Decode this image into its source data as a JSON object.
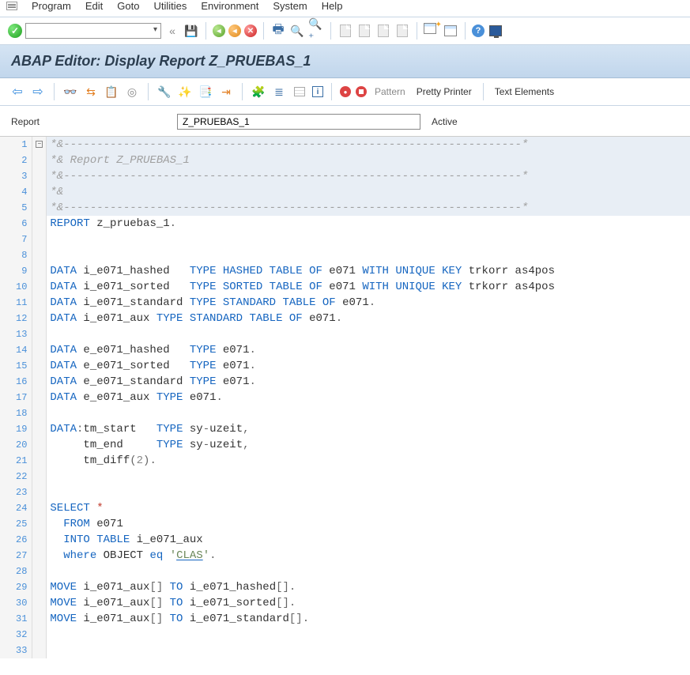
{
  "menubar": {
    "items": [
      "Program",
      "Edit",
      "Goto",
      "Utilities",
      "Environment",
      "System",
      "Help"
    ]
  },
  "title": "ABAP Editor: Display Report Z_PRUEBAS_1",
  "apptoolbar": {
    "pattern": "Pattern",
    "pretty": "Pretty Printer",
    "textelem": "Text Elements"
  },
  "report": {
    "label": "Report",
    "value": "Z_PRUEBAS_1",
    "status": "Active"
  },
  "code": {
    "lines": [
      {
        "n": 1,
        "hl": true,
        "html": "<span class='cmt'>*&---------------------------------------------------------------------*</span>"
      },
      {
        "n": 2,
        "hl": true,
        "html": "<span class='cmt'>*& Report Z_PRUEBAS_1</span>"
      },
      {
        "n": 3,
        "hl": true,
        "html": "<span class='cmt'>*&---------------------------------------------------------------------*</span>"
      },
      {
        "n": 4,
        "hl": true,
        "html": "<span class='cmt'>*&</span>"
      },
      {
        "n": 5,
        "hl": true,
        "html": "<span class='cmt'>*&---------------------------------------------------------------------*</span>"
      },
      {
        "n": 6,
        "hl": false,
        "html": "<span class='kw'>REPORT</span> <span class='id'>z_pruebas_1</span><span class='op'>.</span>"
      },
      {
        "n": 7,
        "hl": false,
        "html": ""
      },
      {
        "n": 8,
        "hl": false,
        "html": ""
      },
      {
        "n": 9,
        "hl": false,
        "html": "<span class='kw'>DATA</span> <span class='id'>i_e071_hashed</span>   <span class='kw'>TYPE HASHED TABLE OF</span> <span class='id'>e071</span> <span class='kw'>WITH UNIQUE KEY</span> <span class='id'>trkorr as4pos</span>"
      },
      {
        "n": 10,
        "hl": false,
        "html": "<span class='kw'>DATA</span> <span class='id'>i_e071_sorted</span>   <span class='kw'>TYPE SORTED TABLE OF</span> <span class='id'>e071</span> <span class='kw'>WITH UNIQUE KEY</span> <span class='id'>trkorr as4pos</span>"
      },
      {
        "n": 11,
        "hl": false,
        "html": "<span class='kw'>DATA</span> <span class='id'>i_e071_standard</span> <span class='kw'>TYPE STANDARD TABLE OF</span> <span class='id'>e071</span><span class='op'>.</span>"
      },
      {
        "n": 12,
        "hl": false,
        "html": "<span class='kw'>DATA</span> <span class='id'>i_e071_aux</span> <span class='kw'>TYPE STANDARD TABLE OF</span> <span class='id'>e071</span><span class='op'>.</span>"
      },
      {
        "n": 13,
        "hl": false,
        "html": ""
      },
      {
        "n": 14,
        "hl": false,
        "html": "<span class='kw'>DATA</span> <span class='id'>e_e071_hashed</span>   <span class='kw'>TYPE</span> <span class='id'>e071</span><span class='op'>.</span>"
      },
      {
        "n": 15,
        "hl": false,
        "html": "<span class='kw'>DATA</span> <span class='id'>e_e071_sorted</span>   <span class='kw'>TYPE</span> <span class='id'>e071</span><span class='op'>.</span>"
      },
      {
        "n": 16,
        "hl": false,
        "html": "<span class='kw'>DATA</span> <span class='id'>e_e071_standard</span> <span class='kw'>TYPE</span> <span class='id'>e071</span><span class='op'>.</span>"
      },
      {
        "n": 17,
        "hl": false,
        "html": "<span class='kw'>DATA</span> <span class='id'>e_e071_aux</span> <span class='kw'>TYPE</span> <span class='id'>e071</span><span class='op'>.</span>"
      },
      {
        "n": 18,
        "hl": false,
        "html": ""
      },
      {
        "n": 19,
        "hl": false,
        "html": "<span class='kw'>DATA</span><span class='op'>:</span><span class='id'>tm_start</span>   <span class='kw'>TYPE</span> <span class='id'>sy</span><span class='op'>-</span><span class='id'>uzeit</span><span class='op'>,</span>"
      },
      {
        "n": 20,
        "hl": false,
        "html": "     <span class='id'>tm_end</span>     <span class='kw'>TYPE</span> <span class='id'>sy</span><span class='op'>-</span><span class='id'>uzeit</span><span class='op'>,</span>"
      },
      {
        "n": 21,
        "hl": false,
        "html": "     <span class='id'>tm_diff</span><span class='op'>(</span><span class='num'>2</span><span class='op'>).</span>"
      },
      {
        "n": 22,
        "hl": false,
        "html": ""
      },
      {
        "n": 23,
        "hl": false,
        "html": ""
      },
      {
        "n": 24,
        "hl": false,
        "html": "<span class='kw'>SELECT</span> <span class='star'>*</span>"
      },
      {
        "n": 25,
        "hl": false,
        "html": "  <span class='kw'>FROM</span> <span class='id'>e071</span>"
      },
      {
        "n": 26,
        "hl": false,
        "html": "  <span class='kw'>INTO TABLE</span> <span class='id'>i_e071_aux</span>"
      },
      {
        "n": 27,
        "hl": false,
        "html": "  <span class='kw'>where</span> <span class='id'>OBJECT</span> <span class='kw'>eq</span> <span class='str'>'<span class='underline'>CLAS</span>'</span><span class='op'>.</span>"
      },
      {
        "n": 28,
        "hl": false,
        "html": ""
      },
      {
        "n": 29,
        "hl": false,
        "html": "<span class='kw'>MOVE</span> <span class='id'>i_e071_aux</span><span class='op'>[]</span> <span class='kw'>TO</span> <span class='id'>i_e071_hashed</span><span class='op'>[].</span>"
      },
      {
        "n": 30,
        "hl": false,
        "html": "<span class='kw'>MOVE</span> <span class='id'>i_e071_aux</span><span class='op'>[]</span> <span class='kw'>TO</span> <span class='id'>i_e071_sorted</span><span class='op'>[].</span>"
      },
      {
        "n": 31,
        "hl": false,
        "html": "<span class='kw'>MOVE</span> <span class='id'>i_e071_aux</span><span class='op'>[]</span> <span class='kw'>TO</span> <span class='id'>i_e071_standard</span><span class='op'>[].</span>"
      },
      {
        "n": 32,
        "hl": false,
        "html": ""
      },
      {
        "n": 33,
        "hl": false,
        "html": ""
      }
    ]
  }
}
